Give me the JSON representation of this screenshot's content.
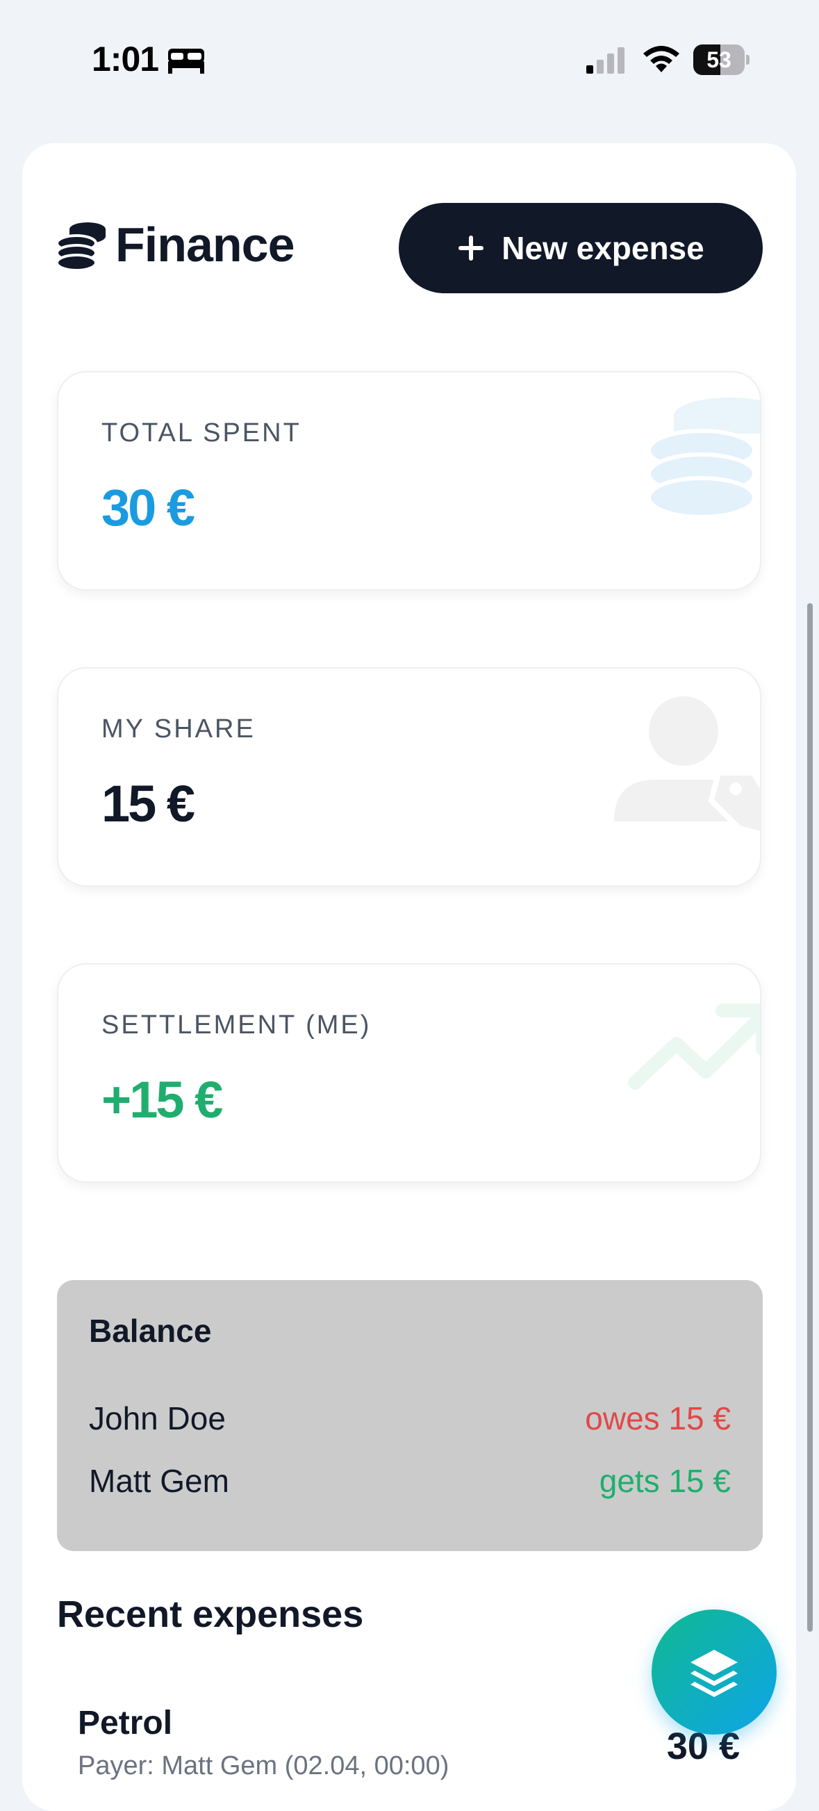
{
  "status": {
    "time": "1:01",
    "battery": "53",
    "battery_level": 0.53,
    "focus_icon": "bed-icon",
    "signal_icon": "cellular-signal-icon",
    "wifi_icon": "wifi-icon"
  },
  "header": {
    "title": "Finance",
    "logo_icon": "coins-stack-icon",
    "new_expense_label": "New expense"
  },
  "stats": {
    "total_spent": {
      "label": "TOTAL SPENT",
      "value": "30 €",
      "color": "#1a9be0",
      "icon": "coins-icon"
    },
    "my_share": {
      "label": "MY SHARE",
      "value": "15 €",
      "color": "#111827",
      "icon": "user-tag-icon"
    },
    "settlement": {
      "label": "SETTLEMENT (ME)",
      "value": "+15 €",
      "color": "#1fae6e",
      "icon": "trend-up-icon"
    }
  },
  "balance": {
    "title": "Balance",
    "rows": [
      {
        "name": "John Doe",
        "amount": "owes 15 €"
      },
      {
        "name": "Matt Gem",
        "amount": "gets 15 €"
      }
    ]
  },
  "recent": {
    "title": "Recent expenses",
    "items": [
      {
        "name": "Petrol",
        "meta": "Payer: Matt Gem (02.04, 00:00)",
        "amount": "30 €"
      }
    ]
  },
  "fab": {
    "icon": "layers-icon"
  }
}
